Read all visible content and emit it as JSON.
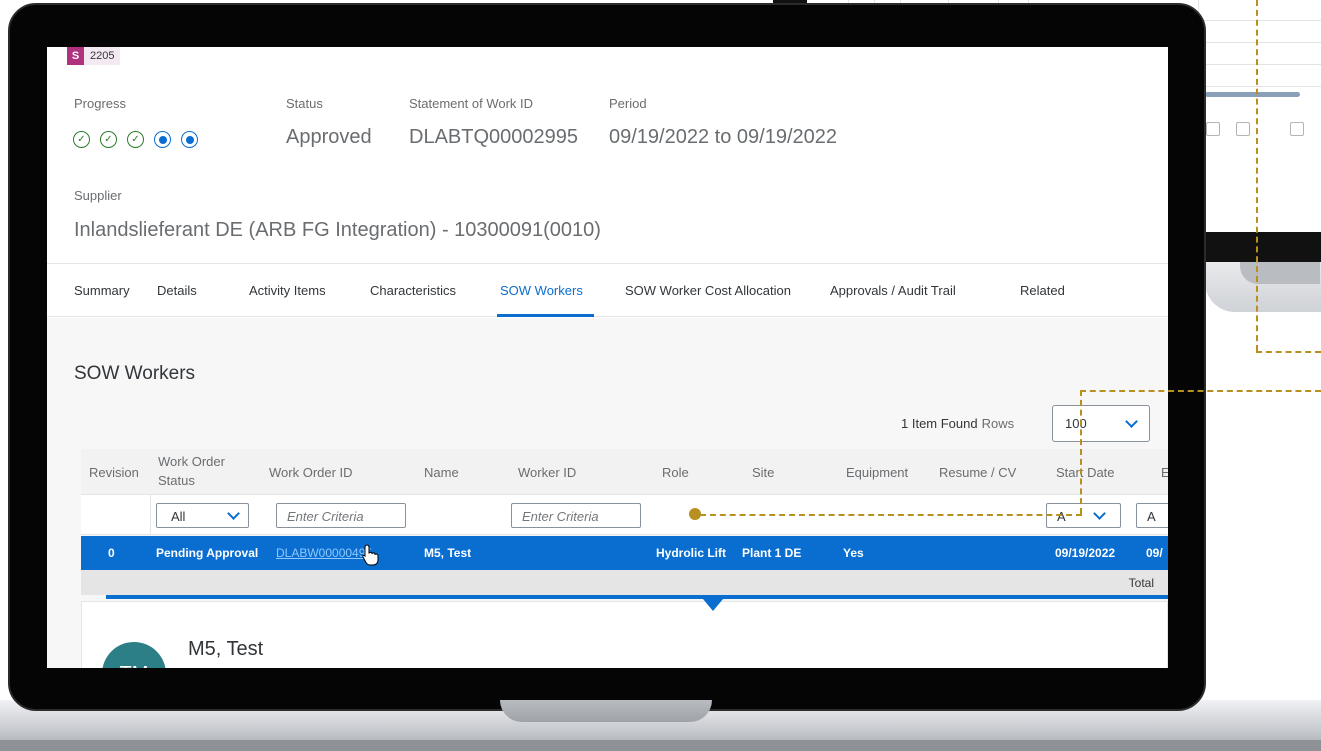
{
  "badge": {
    "letter": "S",
    "number": "2205"
  },
  "header": {
    "progress_label": "Progress",
    "status_label": "Status",
    "status_value": "Approved",
    "sow_id_label": "Statement of Work ID",
    "sow_id_value": "DLABTQ00002995",
    "period_label": "Period",
    "period_value": "09/19/2022 to 09/19/2022",
    "progress_steps": [
      "done",
      "done",
      "done",
      "current",
      "current"
    ]
  },
  "supplier": {
    "label": "Supplier",
    "value": "Inlandslieferant DE (ARB FG Integration) - 10300091(0010)"
  },
  "tabs": [
    {
      "label": "Summary"
    },
    {
      "label": "Details"
    },
    {
      "label": "Activity Items"
    },
    {
      "label": "Characteristics"
    },
    {
      "label": "SOW Workers",
      "active": true
    },
    {
      "label": "SOW Worker Cost Allocation"
    },
    {
      "label": "Approvals / Audit Trail"
    },
    {
      "label": "Related"
    }
  ],
  "section": {
    "title": "SOW Workers",
    "items_found": "1 Item Found",
    "rows_label": "Rows",
    "rows_value": "100"
  },
  "table": {
    "headers": {
      "revision": "Revision",
      "wo_status_1": "Work Order",
      "wo_status_2": "Status",
      "wo_id": "Work Order ID",
      "name": "Name",
      "worker_id": "Worker ID",
      "role": "Role",
      "site": "Site",
      "equipment": "Equipment",
      "resume": "Resume / CV",
      "start_date": "Start Date",
      "end_date_partial": "E"
    },
    "filters": {
      "status_value": "All",
      "wo_id_placeholder": "Enter Criteria",
      "worker_id_placeholder": "Enter Criteria",
      "start_date_value": "A",
      "end_date_value": "A"
    },
    "rows": [
      {
        "revision": "0",
        "status": "Pending Approval",
        "wo_id": "DLABW00000495",
        "name": "M5, Test",
        "role": "Hydrolic Lift",
        "site": "Plant 1 DE",
        "equipment": "Yes",
        "start_date": "09/19/2022",
        "end_date_partial": "09/"
      }
    ],
    "total_label": "Total"
  },
  "detail": {
    "avatar_initials": "TM",
    "name": "M5, Test"
  },
  "colors": {
    "accent": "#0a6ed1",
    "success": "#2b7c2b",
    "badge": "#b0317d",
    "annotation": "#b8901f"
  },
  "icons": [
    "checkmark-circle-icon",
    "radio-dot-icon",
    "chevron-down-icon",
    "hand-cursor-icon"
  ]
}
